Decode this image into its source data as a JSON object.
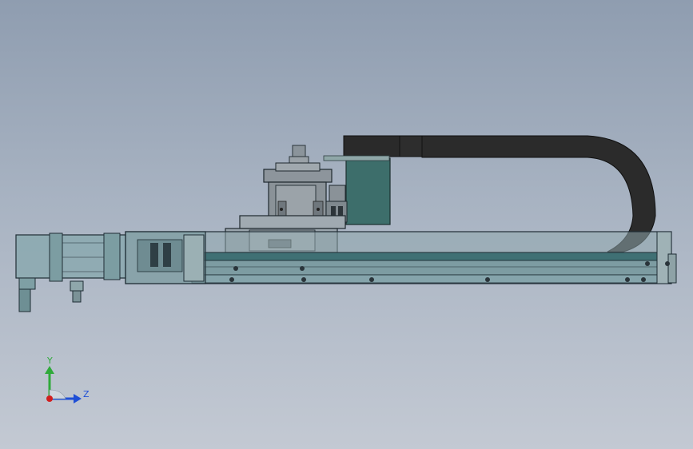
{
  "viewport": {
    "background_top": "#8f9db0",
    "background_bottom": "#c3c9d3"
  },
  "model": {
    "description_icon": "linear-module-assembly",
    "colors": {
      "frame_teal": "#3f6f73",
      "glass_teal": "#7aa3a8",
      "cable_chain": "#2a2a2a",
      "motor_block": "#3e6e6c",
      "edge_dark": "#1f2d35",
      "metal_gray": "#8a9299"
    }
  },
  "triad": {
    "y_label": "Y",
    "z_label": "Z",
    "y_color": "#2faa3a",
    "z_color": "#1f4fd6",
    "x_color": "#d21f1f"
  }
}
